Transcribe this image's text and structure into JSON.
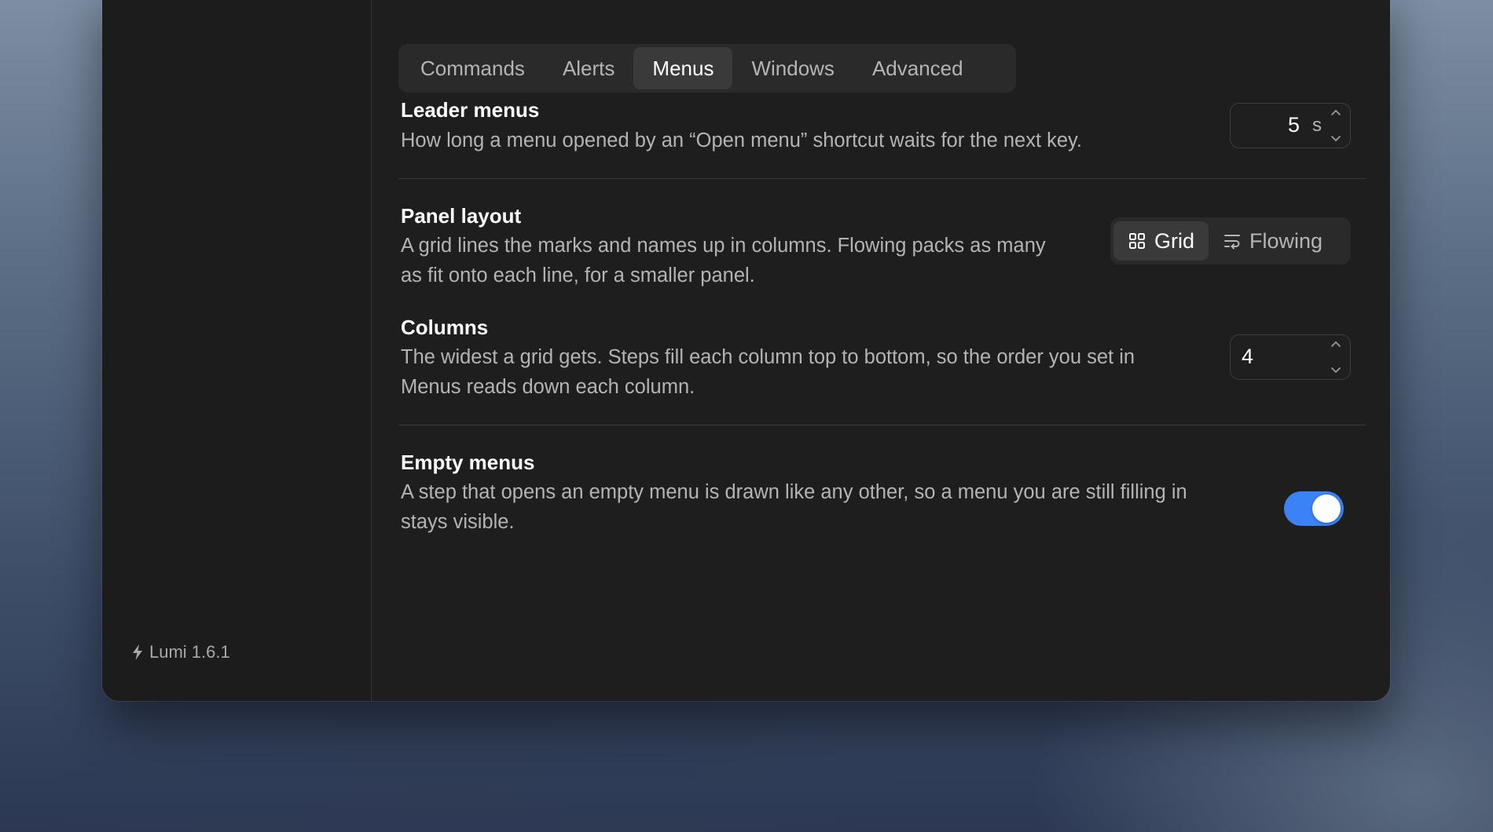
{
  "tabs": [
    {
      "label": "Commands",
      "active": false
    },
    {
      "label": "Alerts",
      "active": false
    },
    {
      "label": "Menus",
      "active": true
    },
    {
      "label": "Windows",
      "active": false
    },
    {
      "label": "Advanced",
      "active": false
    }
  ],
  "sidebar": {
    "version_label": "Lumi 1.6.1",
    "version_icon": "bolt-icon"
  },
  "settings": {
    "leader_menus": {
      "title": "Leader menus",
      "description": "How long a menu opened by an “Open menu” shortcut waits for the next key.",
      "value": "5",
      "unit": "s"
    },
    "panel_layout": {
      "title": "Panel layout",
      "description_line1": "A grid lines the marks and names up in columns. Flowing packs as many",
      "description_line2": "as fit onto each line, for a smaller panel.",
      "options": [
        {
          "label": "Grid",
          "icon": "grid-icon",
          "selected": true
        },
        {
          "label": "Flowing",
          "icon": "text-wrap-icon",
          "selected": false
        }
      ]
    },
    "columns": {
      "title": "Columns",
      "description_line1": "The widest a grid gets. Steps fill each column top to bottom, so the order you set in",
      "description_line2": "Menus reads down each column.",
      "value": "4"
    },
    "empty_menus": {
      "title": "Empty menus",
      "description_line1": "A step that opens an empty menu is drawn like any other, so a menu you are still filling in",
      "description_line2": "stays visible.",
      "enabled": true
    }
  },
  "colors": {
    "accent": "#3a82f6",
    "window_bg": "#1e1e1e",
    "sidebar_bg": "#1c1c1c"
  }
}
